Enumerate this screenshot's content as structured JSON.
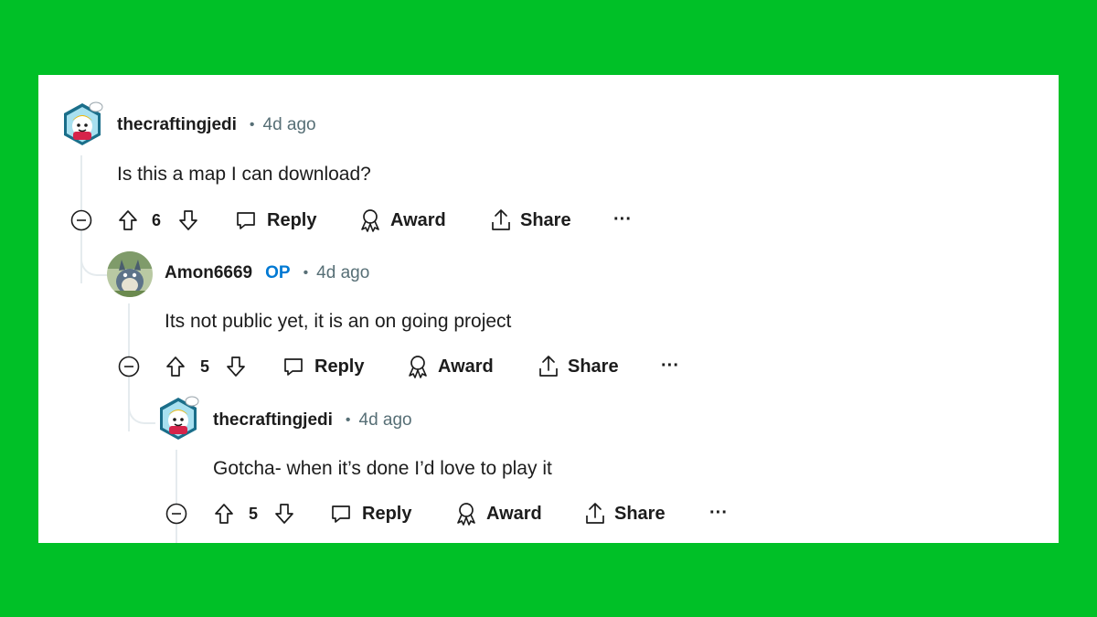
{
  "comments": [
    {
      "username": "thecraftingjedi",
      "op_badge": "",
      "separator": "•",
      "time": "4d ago",
      "body": "Is this a map I can download?",
      "votes": "6",
      "reply_label": "Reply",
      "award_label": "Award",
      "share_label": "Share",
      "more_label": "···",
      "avatar_icon": "jedi-avatar-icon"
    },
    {
      "username": "Amon6669",
      "op_badge": "OP",
      "separator": "•",
      "time": "4d ago",
      "body": "Its not public yet, it is an on going project",
      "votes": "5",
      "reply_label": "Reply",
      "award_label": "Award",
      "share_label": "Share",
      "more_label": "···",
      "avatar_icon": "nature-avatar-icon"
    },
    {
      "username": "thecraftingjedi",
      "op_badge": "",
      "separator": "•",
      "time": "4d ago",
      "body": "Gotcha- when it’s done I’d love to play it",
      "votes": "5",
      "reply_label": "Reply",
      "award_label": "Award",
      "share_label": "Share",
      "more_label": "···",
      "avatar_icon": "jedi-avatar-icon"
    }
  ],
  "colors": {
    "background": "#00c027",
    "card": "#ffffff",
    "text": "#1c1c1c",
    "muted": "#576f76",
    "op": "#0079d3",
    "thread_line": "#e5ebee"
  }
}
